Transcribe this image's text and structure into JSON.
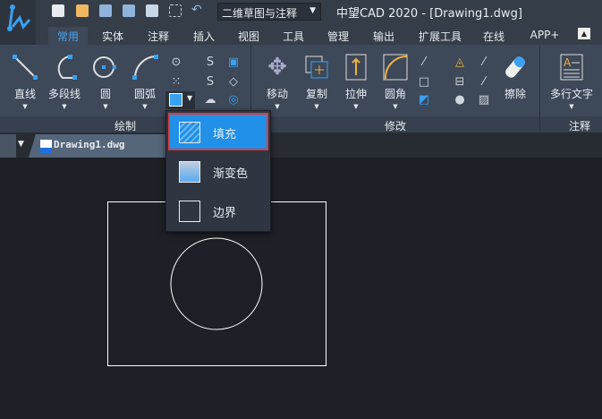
{
  "app_title": "中望CAD 2020 - [Drawing1.dwg]",
  "workspace": "二维草图与注释",
  "tabs": [
    "常用",
    "实体",
    "注释",
    "插入",
    "视图",
    "工具",
    "管理",
    "输出",
    "扩展工具",
    "在线",
    "APP+"
  ],
  "draw_panel": {
    "label": "绘制",
    "tools": [
      "直线",
      "多段线",
      "圆",
      "圆弧"
    ]
  },
  "modify_panel": {
    "label": "修改",
    "tools": [
      "移动",
      "复制",
      "拉伸",
      "圆角",
      "擦除"
    ]
  },
  "annotate_panel": {
    "label": "注释",
    "tools": [
      "多行文字"
    ]
  },
  "doc_tab": "Drawing1.dwg",
  "hatch_menu": {
    "items": [
      "填充",
      "渐变色",
      "边界"
    ],
    "selected": "填充"
  },
  "colors": {
    "accent": "#2090e8",
    "highlight_border": "#e23b3b"
  }
}
